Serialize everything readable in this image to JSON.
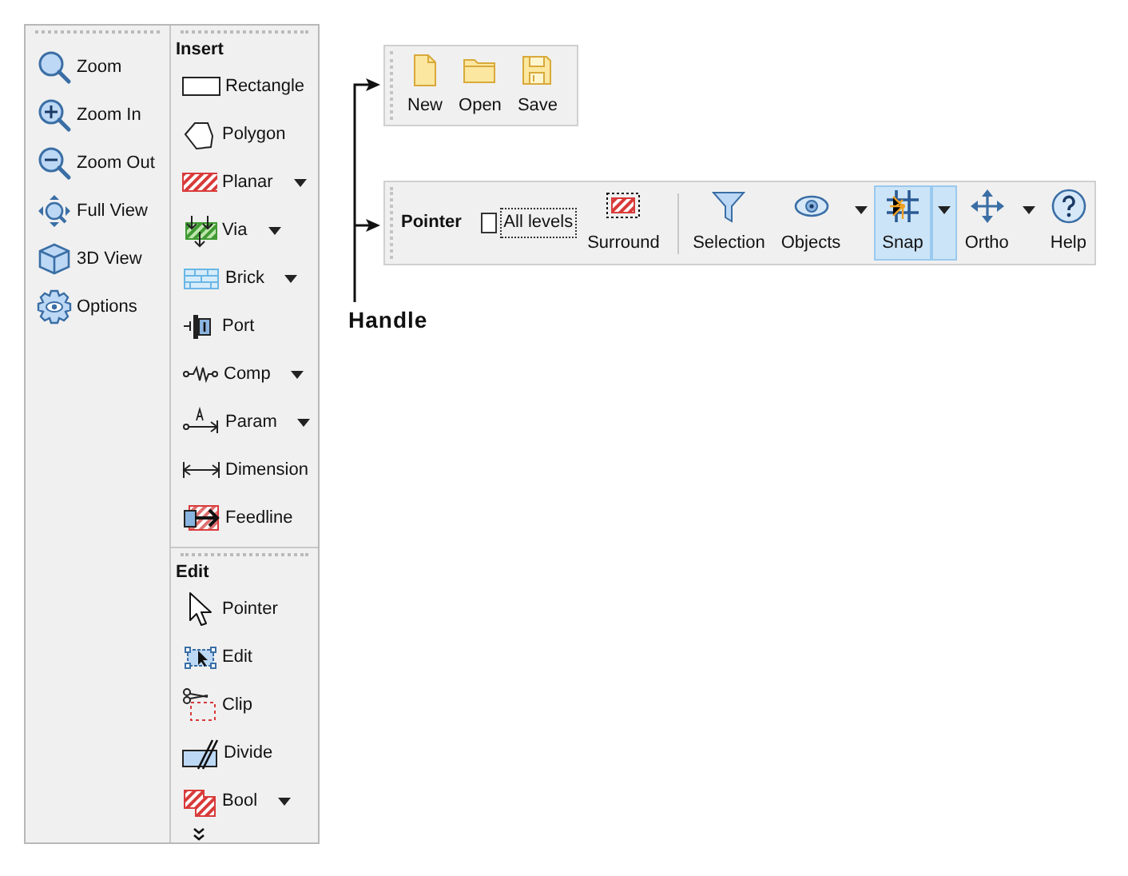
{
  "view_panel": {
    "items": [
      {
        "label": "Zoom"
      },
      {
        "label": "Zoom In"
      },
      {
        "label": "Zoom Out"
      },
      {
        "label": "Full View"
      },
      {
        "label": "3D View"
      },
      {
        "label": "Options"
      }
    ]
  },
  "insert_panel": {
    "title": "Insert",
    "items": [
      {
        "label": "Rectangle",
        "dropdown": false
      },
      {
        "label": "Polygon",
        "dropdown": false
      },
      {
        "label": "Planar",
        "dropdown": true
      },
      {
        "label": "Via",
        "dropdown": true
      },
      {
        "label": "Brick",
        "dropdown": true
      },
      {
        "label": "Port",
        "dropdown": false
      },
      {
        "label": "Comp",
        "dropdown": true
      },
      {
        "label": "Param",
        "dropdown": true
      },
      {
        "label": "Dimension",
        "dropdown": false
      },
      {
        "label": "Feedline",
        "dropdown": false
      }
    ]
  },
  "edit_panel": {
    "title": "Edit",
    "items": [
      {
        "label": "Pointer",
        "dropdown": false
      },
      {
        "label": "Edit",
        "dropdown": false
      },
      {
        "label": "Clip",
        "dropdown": false
      },
      {
        "label": "Divide",
        "dropdown": false
      },
      {
        "label": "Bool",
        "dropdown": true
      }
    ]
  },
  "file_toolbar": {
    "buttons": [
      {
        "label": "New"
      },
      {
        "label": "Open"
      },
      {
        "label": "Save"
      }
    ]
  },
  "pointer_toolbar": {
    "title": "Pointer",
    "all_levels": {
      "label": "All levels",
      "checked": false,
      "focused": true
    },
    "buttons": [
      {
        "label": "Surround",
        "dropdown": false,
        "selected": false
      },
      {
        "label": "Selection",
        "dropdown": false,
        "selected": false
      },
      {
        "label": "Objects",
        "dropdown": true,
        "selected": false
      },
      {
        "label": "Snap",
        "dropdown": true,
        "selected": true
      },
      {
        "label": "Ortho",
        "dropdown": true,
        "selected": false
      },
      {
        "label": "Help",
        "dropdown": false,
        "selected": false
      }
    ]
  },
  "annotation": {
    "label": "Handle"
  }
}
